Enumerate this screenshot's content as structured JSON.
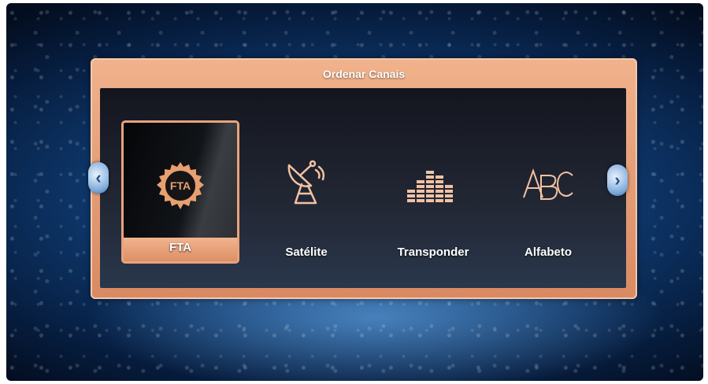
{
  "dialog": {
    "title": "Ordenar Canais"
  },
  "items": [
    {
      "label": "FTA",
      "icon": "fta-badge-icon",
      "selected": true
    },
    {
      "label": "Satélite",
      "icon": "satellite-dish-icon",
      "selected": false
    },
    {
      "label": "Transponder",
      "icon": "signal-bars-icon",
      "selected": false
    },
    {
      "label": "Alfabeto",
      "icon": "abc-icon",
      "selected": false
    }
  ],
  "nav": {
    "left_glyph": "‹",
    "right_glyph": "›"
  },
  "colors": {
    "accent": "#e9a27c",
    "icon": "#f2c2a2",
    "background": "#0e3a70"
  }
}
